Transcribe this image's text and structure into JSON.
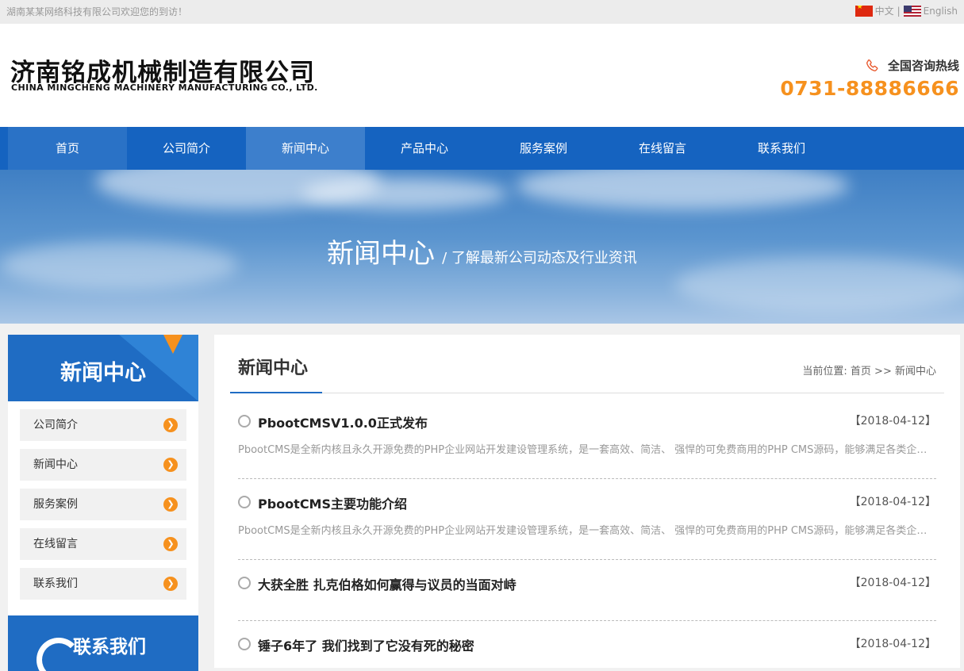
{
  "topbar": {
    "welcome": "湖南某某网络科技有限公司欢迎您的到访！",
    "lang_cn": "中文",
    "lang_sep": "|",
    "lang_en": "English"
  },
  "header": {
    "logo_cn": "济南铭成机械制造有限公司",
    "logo_en": "CHINA MINGCHENG MACHINERY MANUFACTURING CO., LTD.",
    "hotline_label": "全国咨询热线",
    "hotline_number": "0731-88886666"
  },
  "nav": {
    "items": [
      "首页",
      "公司简介",
      "新闻中心",
      "产品中心",
      "服务案例",
      "在线留言",
      "联系我们"
    ],
    "active": "新闻中心"
  },
  "banner": {
    "title": "新闻中心",
    "subtitle": "/ 了解最新公司动态及行业资讯"
  },
  "sidebar": {
    "title": "新闻中心",
    "items": [
      "公司简介",
      "新闻中心",
      "服务案例",
      "在线留言",
      "联系我们"
    ],
    "contact_title": "联系我们"
  },
  "content": {
    "title": "新闻中心",
    "breadcrumb_prefix": "当前位置:",
    "breadcrumb_home": "首页",
    "breadcrumb_sep": ">>",
    "breadcrumb_current": "新闻中心",
    "news": [
      {
        "title": "PbootCMSV1.0.0正式发布",
        "date": "【2018-04-12】",
        "desc": "PbootCMS是全新内核且永久开源免费的PHP企业网站开发建设管理系统，是一套高效、简洁、 强悍的可免费商用的PHP CMS源码，能够满足各类企业网站开发建设的需要。"
      },
      {
        "title": "PbootCMS主要功能介绍",
        "date": "【2018-04-12】",
        "desc": "PbootCMS是全新内核且永久开源免费的PHP企业网站开发建设管理系统，是一套高效、简洁、 强悍的可免费商用的PHP CMS源码，能够满足各类企业网站开发建设的需要。"
      },
      {
        "title": "大获全胜 扎克伯格如何赢得与议员的当面对峙",
        "date": "【2018-04-12】",
        "desc": ""
      },
      {
        "title": "锤子6年了 我们找到了它没有死的秘密",
        "date": "【2018-04-12】",
        "desc": ""
      }
    ]
  },
  "colors": {
    "brand_blue": "#1563c0",
    "accent_orange": "#f6911e"
  }
}
